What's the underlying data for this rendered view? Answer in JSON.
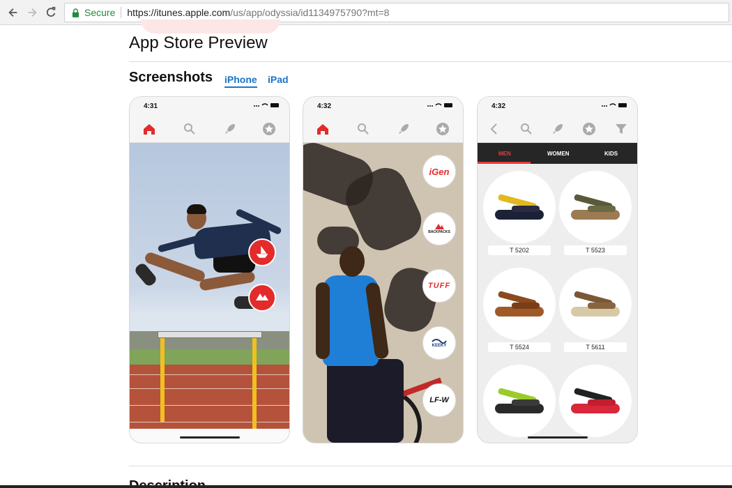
{
  "browser": {
    "secure_label": "Secure",
    "url_host": "https://itunes.apple.com",
    "url_rest": "/us/app/odyssia/id1134975790?mt=8"
  },
  "page": {
    "title": "App Store Preview",
    "screenshots_heading": "Screenshots",
    "tabs": [
      {
        "label": "iPhone",
        "active": true
      },
      {
        "label": "iPad",
        "active": false
      }
    ],
    "description_heading": "Description"
  },
  "phones": [
    {
      "time": "4:31"
    },
    {
      "time": "4:32",
      "brands": [
        "iGen",
        "BACKPACKS",
        "TUFF",
        "KEEKY",
        "LF-W"
      ]
    },
    {
      "time": "4:32",
      "categories": [
        "MEN",
        "WOMEN",
        "KIDS"
      ],
      "products": [
        {
          "label": "T 5202"
        },
        {
          "label": "T 5523"
        },
        {
          "label": "T 5524"
        },
        {
          "label": "T 5611"
        }
      ]
    }
  ],
  "colors": {
    "accent": "#1a73c8",
    "brand_red": "#e32b2b",
    "secure_green": "#1e8c3a"
  }
}
